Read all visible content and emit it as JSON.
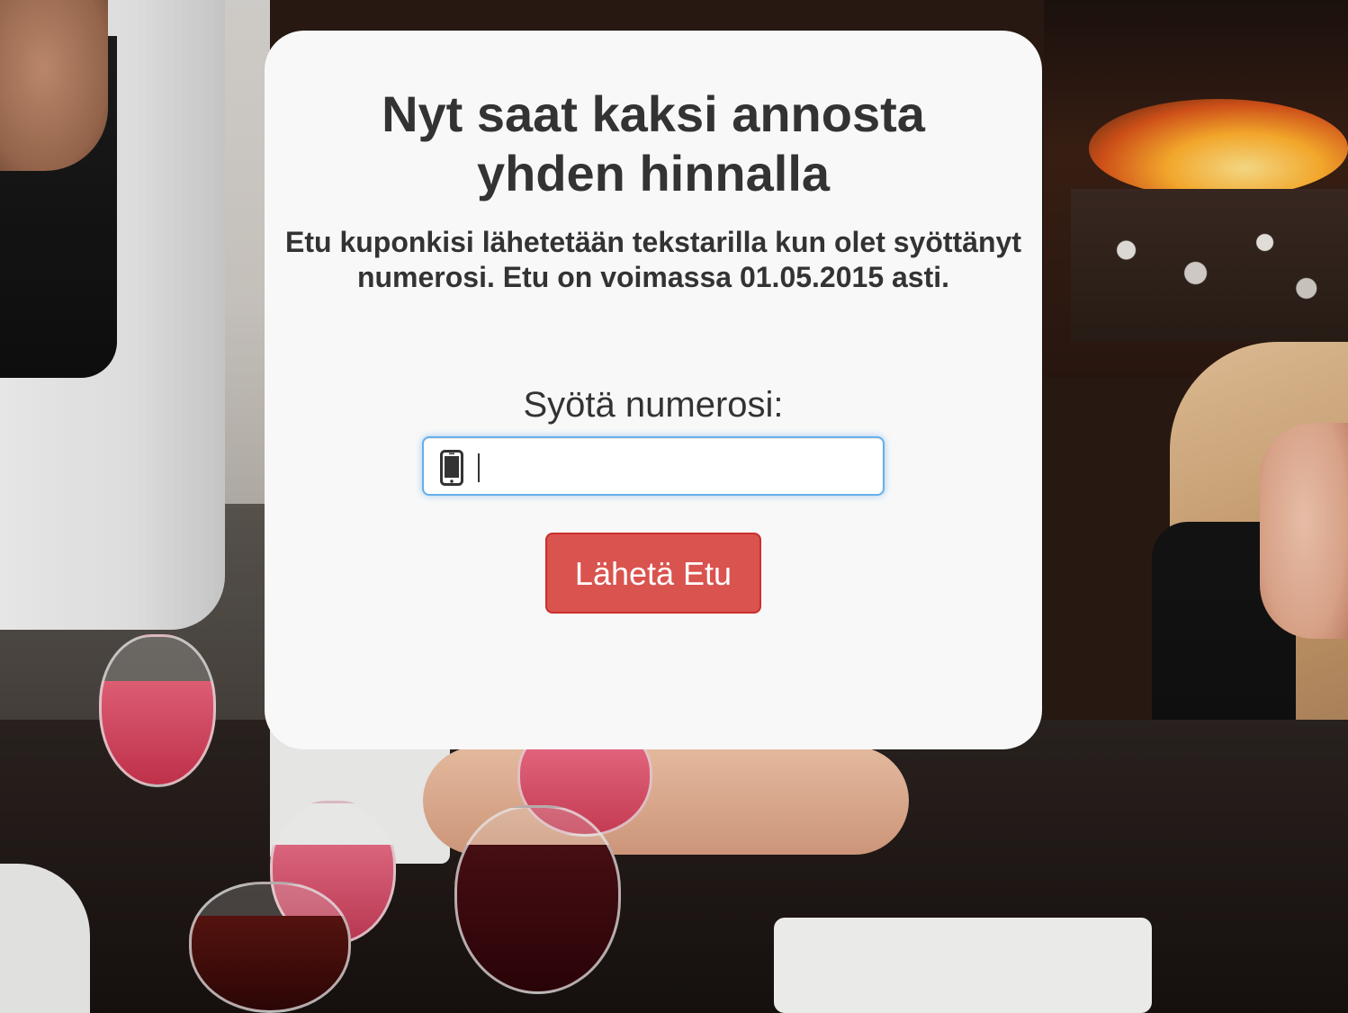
{
  "background": {
    "scene": "restaurant-dinner-photo"
  },
  "modal": {
    "title_line1": "Nyt saat kaksi annosta",
    "title_line2": "yhden hinnalla",
    "subtitle": "Etu kuponkisi lähetetään tekstarilla kun olet syöttänyt numerosi. Etu on voimassa 01.05.2015 asti.",
    "input_label": "Syötä numerosi:",
    "phone_input": {
      "value": "",
      "placeholder": "",
      "icon": "mobile-phone-icon"
    },
    "submit_label": "Lähetä Etu"
  },
  "colors": {
    "button": "#d9534f",
    "input_focus": "#66afe9",
    "modal_bg": "#f8f8f8",
    "text": "#333333"
  }
}
